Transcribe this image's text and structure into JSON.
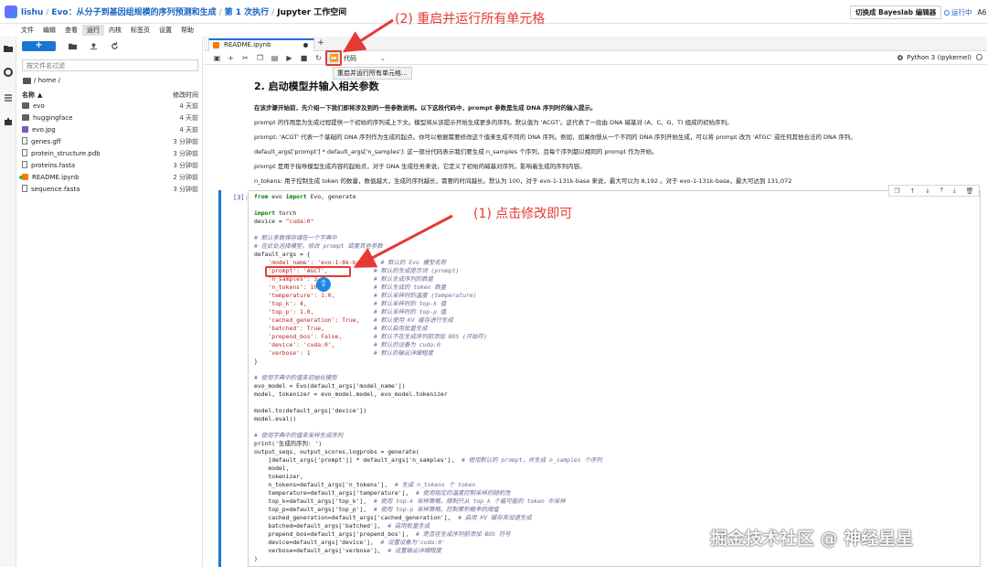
{
  "header": {
    "user": "lishu",
    "project": "Evo：从分子到基因组规模的序列预测和生成",
    "run": "第 1 次执行",
    "workspace": "Jupyter 工作空间",
    "switch_button": "切换成 Bayeslab 编辑器",
    "status": "运行中",
    "status_extra": "A6"
  },
  "menu": [
    "文件",
    "编辑",
    "查看",
    "运行",
    "内核",
    "标签页",
    "设置",
    "帮助"
  ],
  "menu_active_index": 3,
  "filebrowser": {
    "new_label": "+",
    "filter_placeholder": "按文件名过滤",
    "path": "/ home /",
    "col_name": "名称",
    "col_name_arrow": "▲",
    "col_modified": "修改时间",
    "files": [
      {
        "name": "evo",
        "when": "4 天前",
        "kind": "folder"
      },
      {
        "name": "huggingface",
        "when": "4 天前",
        "kind": "folder"
      },
      {
        "name": "evo.jpg",
        "when": "4 天前",
        "kind": "img"
      },
      {
        "name": "genes.gff",
        "when": "3 分钟前",
        "kind": "doc"
      },
      {
        "name": "protein_structure.pdb",
        "when": "3 分钟前",
        "kind": "doc"
      },
      {
        "name": "proteins.fasta",
        "when": "3 分钟前",
        "kind": "doc"
      },
      {
        "name": "README.ipynb",
        "when": "2 分钟前",
        "kind": "nb"
      },
      {
        "name": "sequence.fasta",
        "when": "3 分钟前",
        "kind": "doc"
      }
    ]
  },
  "notebook": {
    "tab_name": "README.ipynb",
    "cell_type": "代码",
    "kernel": "Python 3 (ipykernel)",
    "tooltip": "重启并运行所有单元格...",
    "cell_prompt": "[3]:"
  },
  "markdown": {
    "heading": "2. 启动模型并输入相关参数",
    "p1": "在该步骤开始前，先介绍一下我们即将涉及到的一些参数说明。以下这段代码中，prompt 参数是生成 DNA 序列时的输入提示。",
    "p2": "prompt 的作用是为生成过程提供一个初始的序列或上下文。模型将从该提示开始生成更多的序列。默认值为 'ACGT'。这代表了一段由 DNA 碱基对 (A、C、G、T) 组成的初始序列。",
    "p3": "prompt: 'ACGT' 代表一个基础的 DNA 序列作为生成的起点。你可以根据需要修改这个值来生成不同的 DNA 序列。例如，如果你想从一个不同的 DNA 序列开始生成，可以将 prompt 改为 'ATGC' 或任何其他合法的 DNA 序列。",
    "p4": "default_args['prompt'] * default_args['n_samples']: 这一部分代码表示我们要生成 n_samples 个序列，且每个序列都以相同的 prompt 作为开始。",
    "p5": "prompt 是用于指导模型生成内容的起始点，对于 DNA 生成任务来说，它定义了初始的碱基对序列，影响着生成的序列内容。",
    "p6": "n_tokens: 用于控制生成 token 的数量，数值越大，生成的序列越长，需要的时间越长。默认为 100，对于 evo-1-131k-base 来说，最大可以为 8,192 。对于 evo-1-131k-base，最大可达到 131,072"
  },
  "code": {
    "l01_a": "from",
    "l01_b": " evo ",
    "l01_c": "import",
    "l01_d": " Evo, generate",
    "l03_a": "import",
    "l03_b": " torch",
    "l04_a": "device = ",
    "l04_b": "\"cuda:0\"",
    "l06": "# 默认参数保存储在一个字典中",
    "l07": "# 在此处选择模型，修改 prompt 或者其他参数",
    "l08": "default_args = {",
    "l09_a": "    'model_name': 'evo-1-8k-base',",
    "l09_b": "  # 默认的 Evo 模型名称",
    "l10_a": "    'prompt': 'AGCT',",
    "l10_b": "             # 默认的生成提示词 (prompt)",
    "l11_a": "    'n_samples': 3,",
    "l11_b": "               # 默认生成序列的数量",
    "l12_a": "    'n_tokens': 100,",
    "l12_b": "              # 默认生成的 token 数量",
    "l13_a": "    'temperature': 1.0,",
    "l13_b": "           # 默认采样时的温度 (temperature)",
    "l14_a": "    'top_k': 4,",
    "l14_b": "                   # 默认采样时的 top-k 值",
    "l15_a": "    'top_p': 1.0,",
    "l15_b": "                 # 默认采样时的 top-p 值",
    "l16_a": "    'cached_generation': True,",
    "l16_b": "    # 默认使用 KV 缓存进行生成",
    "l17_a": "    'batched': True,",
    "l17_b": "              # 默认启用批量生成",
    "l18_a": "    'prepend_bos': False,",
    "l18_b": "         # 默认不在生成序列前添加 BOS (开始符)",
    "l19_a": "    'device': 'cuda:0',",
    "l19_b": "           # 默认的设备为 cuda:0",
    "l20_a": "    'verbose': 1",
    "l20_b": "                  # 默认的输出详细程度",
    "l21": "}",
    "l23": "# 使用字典中的值来初始化模型",
    "l24": "evo_model = Evo(default_args['model_name'])",
    "l25": "model, tokenizer = evo_model.model, evo_model.tokenizer",
    "l27": "model.to(default_args['device'])",
    "l28": "model.eval()",
    "l30": "# 使用字典中的值来采样生成序列",
    "l31": "print('生成的序列: ')",
    "l32": "output_seqs, output_scores,logprobs = generate(",
    "l33_a": "    [default_args['prompt']] * default_args['n_samples'],",
    "l33_b": "  # 使用默认的 prompt，并生成 n_samples 个序列",
    "l34": "    model,",
    "l35": "    tokenizer,",
    "l36_a": "    n_tokens=default_args['n_tokens'],",
    "l36_b": "  # 生成 n_tokens 个 token",
    "l37_a": "    temperature=default_args['temperature'],",
    "l37_b": "  # 使用指定的温度控制采样的随机性",
    "l38_a": "    top_k=default_args['top_k'],",
    "l38_b": "  # 使用 top-k 采样策略，限制只从 top_k 个最可能的 token 中采样",
    "l39_a": "    top_p=default_args['top_p'],",
    "l39_b": "  # 使用 top-p 采样策略，控制累积概率的阈值",
    "l40_a": "    cached_generation=default_args['cached_generation'],",
    "l40_b": "  # 启用 KV 缓存来加速生成",
    "l41_a": "    batched=default_args['batched'],",
    "l41_b": "  # 启用批量生成",
    "l42_a": "    prepend_bos=default_args['prepend_bos'],",
    "l42_b": "  # 是否在生成序列前添加 BOS 符号",
    "l43_a": "    device=default_args['device'],",
    "l43_b": "  # 设置设备为'cuda:0'",
    "l44_a": "    verbose=default_args['verbose'],",
    "l44_b": "  # 设置输出详细程度",
    "l45": ")"
  },
  "annotations": {
    "step2": "(2) 重启并运行所有单元格",
    "step1": "(1) 点击修改即可",
    "color": "#e53935"
  },
  "watermark": "掘金技术社区 @ 神经星星"
}
